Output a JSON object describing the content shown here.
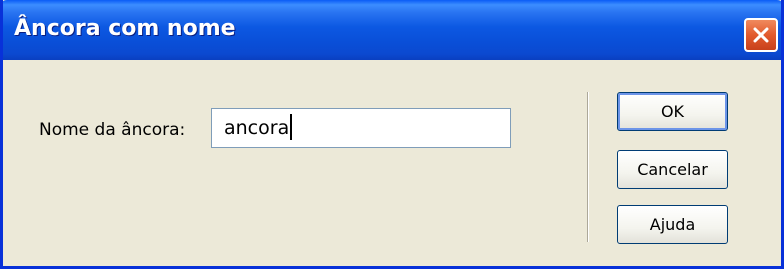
{
  "window": {
    "title": "Âncora com nome"
  },
  "form": {
    "anchor_label": "Nome da âncora:",
    "anchor_value": "ancora"
  },
  "buttons": {
    "ok": "OK",
    "cancel": "Cancelar",
    "help": "Ajuda"
  },
  "icons": {
    "close": "close-icon"
  },
  "colors": {
    "titlebar": "#0a4fd8",
    "close_button": "#e25a2d",
    "dialog_background": "#ece9d8",
    "ok_focus_ring": "#6c94e8"
  }
}
